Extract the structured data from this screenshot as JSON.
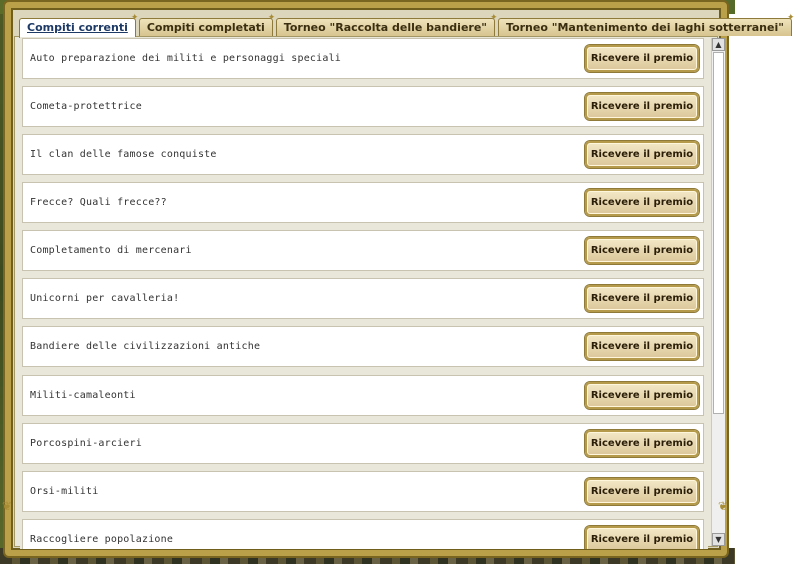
{
  "tabs": [
    {
      "label": "Compiti correnti",
      "active": true
    },
    {
      "label": "Compiti completati",
      "active": false
    },
    {
      "label": "Torneo \"Raccolta delle bandiere\"",
      "active": false
    },
    {
      "label": "Torneo \"Mantenimento dei laghi sotterranei\"",
      "active": false
    }
  ],
  "tasks": [
    {
      "label": "Auto preparazione dei militi e personaggi speciali",
      "button": "Ricevere il premio"
    },
    {
      "label": "Cometa-protettrice",
      "button": "Ricevere il premio"
    },
    {
      "label": "Il clan delle famose conquiste",
      "button": "Ricevere il premio"
    },
    {
      "label": "Frecce? Quali frecce??",
      "button": "Ricevere il premio"
    },
    {
      "label": "Completamento di mercenari",
      "button": "Ricevere il premio"
    },
    {
      "label": "Unicorni per cavalleria!",
      "button": "Ricevere il premio"
    },
    {
      "label": "Bandiere delle civilizzazioni antiche",
      "button": "Ricevere il premio"
    },
    {
      "label": "Militi-camaleonti",
      "button": "Ricevere il premio"
    },
    {
      "label": "Porcospini-arcieri",
      "button": "Ricevere il premio"
    },
    {
      "label": "Orsi-militi",
      "button": "Ricevere il premio"
    },
    {
      "label": "Raccogliere popolazione",
      "button": "Ricevere il premio"
    }
  ],
  "scrollbar": {
    "up_icon": "▲",
    "down_icon": "▼"
  },
  "colors": {
    "frame_gold": "#b9a049",
    "button_bg": "#dcc79a",
    "active_tab_text": "#1d3a66"
  }
}
